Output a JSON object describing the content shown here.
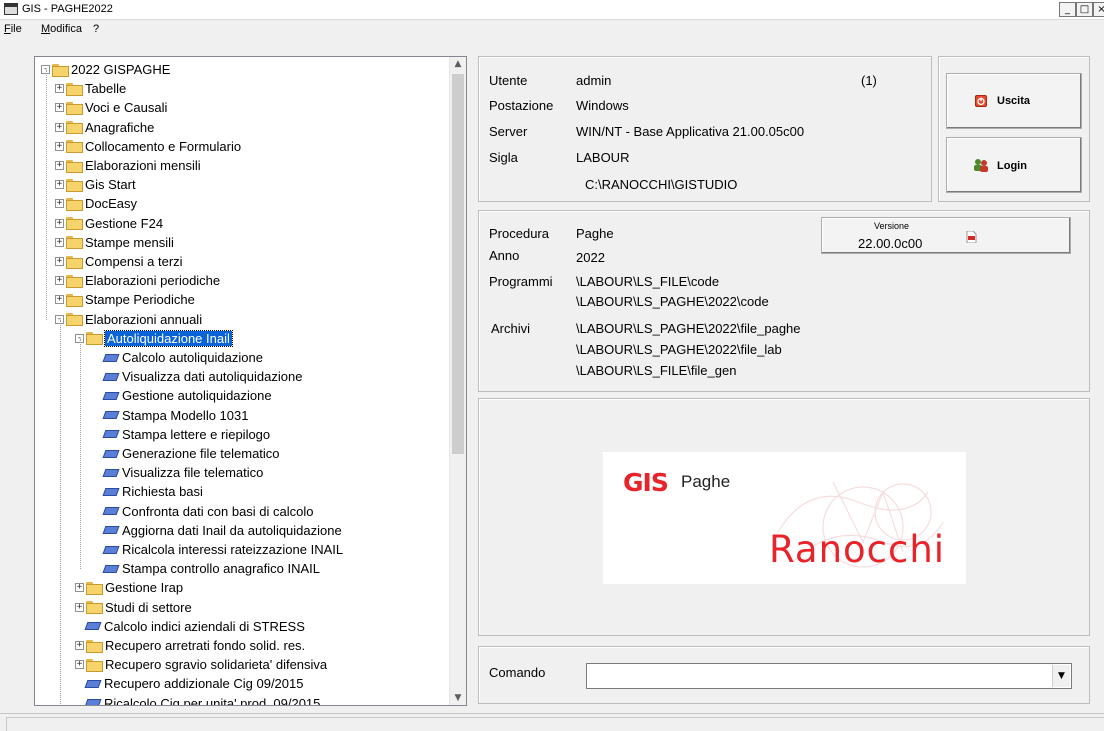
{
  "window": {
    "title": "GIS - PAGHE2022"
  },
  "menu": {
    "file": "File",
    "modifica": "Modifica",
    "help": "?"
  },
  "tree": {
    "root": "2022 GISPAGHE",
    "nodes": [
      "Tabelle",
      "Voci e Causali",
      "Anagrafiche",
      "Collocamento e Formulario",
      "Elaborazioni mensili",
      "Gis Start",
      "DocEasy",
      "Gestione F24",
      "Stampe mensili",
      "Compensi a terzi",
      "Elaborazioni periodiche",
      "Stampe Periodiche",
      "Elaborazioni annuali"
    ],
    "selected": "Autoliquidazione Inail",
    "autoliquidazione_items": [
      "Calcolo autoliquidazione",
      "Visualizza dati autoliquidazione",
      "Gestione autoliquidazione",
      "Stampa Modello 1031",
      "Stampa lettere e riepilogo",
      "Generazione file telematico",
      "Visualizza file telematico",
      "Richiesta basi",
      "Confronta dati con basi di calcolo",
      "Aggiorna dati Inail da autoliquidazione",
      "Ricalcola interessi rateizzazione INAIL",
      "Stampa controllo anagrafico INAIL"
    ],
    "annuali_items": [
      {
        "label": "Gestione Irap",
        "kind": "folder"
      },
      {
        "label": "Studi di settore",
        "kind": "folder"
      },
      {
        "label": "Calcolo indici aziendali di STRESS",
        "kind": "leaf"
      },
      {
        "label": "Recupero arretrati fondo solid. res.",
        "kind": "folder"
      },
      {
        "label": "Recupero sgravio solidarieta' difensiva",
        "kind": "folder"
      },
      {
        "label": "Recupero addizionale Cig 09/2015",
        "kind": "leaf"
      },
      {
        "label": "Ricalcolo Cig per unita' prod. 09/2015",
        "kind": "leaf"
      }
    ]
  },
  "session": {
    "utente_label": "Utente",
    "utente": "admin",
    "count": "(1)",
    "postazione_label": "Postazione",
    "postazione": "Windows",
    "server_label": "Server",
    "server": "WIN/NT - Base Applicativa 21.00.05c00",
    "sigla_label": "Sigla",
    "sigla": "LABOUR",
    "path": "C:\\RANOCCHI\\GISTUDIO"
  },
  "buttons": {
    "uscita": "Uscita",
    "login": "Login"
  },
  "procedura": {
    "procedura_label": "Procedura",
    "procedura": "Paghe",
    "anno_label": "Anno",
    "anno": "2022",
    "programmi_label": "Programmi",
    "programmi_1": "\\LABOUR\\LS_FILE\\code",
    "programmi_2": "\\LABOUR\\LS_PAGHE\\2022\\code",
    "archivi_label": "Archivi",
    "archivi_1": "\\LABOUR\\LS_PAGHE\\2022\\file_paghe",
    "archivi_2": "\\LABOUR\\LS_PAGHE\\2022\\file_lab",
    "archivi_3": "\\LABOUR\\LS_FILE\\file_gen",
    "versione_label": "Versione",
    "versione": "22.00.0c00"
  },
  "logo": {
    "gis": "GIS",
    "paghe": "Paghe",
    "ranocchi": "Ranocchi",
    "accent": "#e8232a"
  },
  "comando": {
    "label": "Comando",
    "value": ""
  },
  "colors": {
    "selection": "#0a64d8",
    "background": "#f0f0f0"
  }
}
